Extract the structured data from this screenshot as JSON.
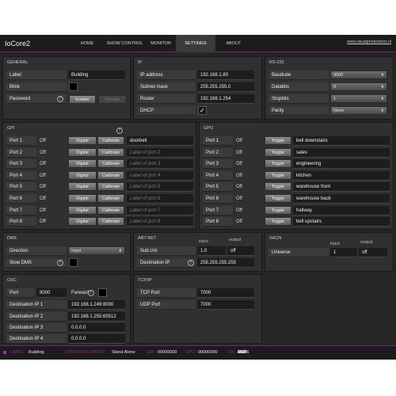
{
  "app": {
    "title": "IoCore2",
    "url": "www.visualproductions.nl"
  },
  "nav": [
    "HOME",
    "SHOW CONTROL",
    "MONITOR",
    "SETTINGS",
    "ABOUT"
  ],
  "general": {
    "title": "GENERAL",
    "label_label": "Label",
    "label_value": "Building",
    "blink_label": "Blink",
    "password_label": "Password",
    "help": "?",
    "enable": "Enable",
    "disable": "Disable"
  },
  "ip": {
    "title": "IP",
    "address_label": "IP address",
    "address": "192.168.1.80",
    "subnet_label": "Subnet mask",
    "subnet": "255.255.255.0",
    "router_label": "Router",
    "router": "192.168.1.254",
    "dhcp_label": "DHCP",
    "dhcp_check": "✓"
  },
  "rs232": {
    "title": "RS-232",
    "baudrate_label": "Baudrate",
    "baudrate": "9600",
    "databits_label": "Databits",
    "databits": "8",
    "stopbits_label": "Stopbits",
    "stopbits": "1",
    "parity_label": "Parity",
    "parity": "None"
  },
  "gpi": {
    "title": "GPI",
    "help": "?",
    "digital": "Digital",
    "calibrate": "Calibrate",
    "rows": [
      {
        "port": "Port 1",
        "state": "Off",
        "label": "doorbell"
      },
      {
        "port": "Port 2",
        "state": "Off",
        "placeholder": "Label of port 2"
      },
      {
        "port": "Port 3",
        "state": "Off",
        "placeholder": "Label of port 3"
      },
      {
        "port": "Port 4",
        "state": "Off",
        "placeholder": "Label of port 4"
      },
      {
        "port": "Port 5",
        "state": "Off",
        "placeholder": "Label of port 5"
      },
      {
        "port": "Port 6",
        "state": "Off",
        "placeholder": "Label of port 6"
      },
      {
        "port": "Port 7",
        "state": "Off",
        "placeholder": "Label of port 7"
      },
      {
        "port": "Port 8",
        "state": "Off",
        "placeholder": "Label of port 8"
      }
    ]
  },
  "gpo": {
    "title": "GPO",
    "toggle": "Toggle",
    "rows": [
      {
        "port": "Port 1",
        "state": "Off",
        "label": "bell downstairs"
      },
      {
        "port": "Port 2",
        "state": "Off",
        "label": "sales"
      },
      {
        "port": "Port 3",
        "state": "Off",
        "label": "engineering"
      },
      {
        "port": "Port 4",
        "state": "Off",
        "label": "kitchen"
      },
      {
        "port": "Port 5",
        "state": "Off",
        "label": "warehouse front"
      },
      {
        "port": "Port 6",
        "state": "Off",
        "label": "warehouse back"
      },
      {
        "port": "Port 7",
        "state": "Off",
        "label": "hallway"
      },
      {
        "port": "Port 8",
        "state": "Off",
        "label": "bell upstairs"
      }
    ]
  },
  "dmx": {
    "title": "DMX",
    "direction_label": "Direction",
    "direction": "Input",
    "slow_label": "Slow DMX",
    "help": "?"
  },
  "artnet": {
    "title": "ART-NET",
    "input_hdr": "input",
    "output_hdr": "output",
    "subuni_label": "Sub.Uni",
    "subuni_in": "1.0",
    "subuni_out": "off",
    "dest_label": "Destination IP",
    "help": "?",
    "dest": "255.255.255.255"
  },
  "sacn": {
    "title": "SACN",
    "input_hdr": "input",
    "output_hdr": "output",
    "universe_label": "Universe",
    "universe_in": "1",
    "universe_out": "off"
  },
  "osc": {
    "title": "OSC",
    "port_label": "Port",
    "port": "8000",
    "forward_label": "Forward",
    "help": "?",
    "dest1_label": "Destination IP 1",
    "dest1": "192.168.1.249:8000",
    "dest2_label": "Destination IP 2",
    "dest2": "192.168.1.255:65512",
    "dest3_label": "Destination IP 3",
    "dest3": "0.0.0.0",
    "dest4_label": "Destination IP 4",
    "dest4": "0.0.0.0"
  },
  "tcpip": {
    "title": "TCP/IP",
    "tcp_label": "TCP Port",
    "tcp": "7000",
    "udp_label": "UDP Port",
    "udp": "7000"
  },
  "status": {
    "label_lbl": "LABEL:",
    "label_val": "Building",
    "mode_lbl": "OPERATING MODE:",
    "mode_val": "Stand Alone",
    "gpi_lbl": "GPI:",
    "gpi_val": "00000000",
    "gpo_lbl": "GPO:",
    "gpo_val": "00000000",
    "rx_lbl": "RX:",
    "rx_tags": [
      "RS-232",
      "DMX",
      "ART",
      "sACN",
      "UDP",
      "TCP",
      "OSC"
    ]
  },
  "colors": {
    "accent": "#8b2a8b",
    "panel": "#303030",
    "background": "#262626"
  }
}
